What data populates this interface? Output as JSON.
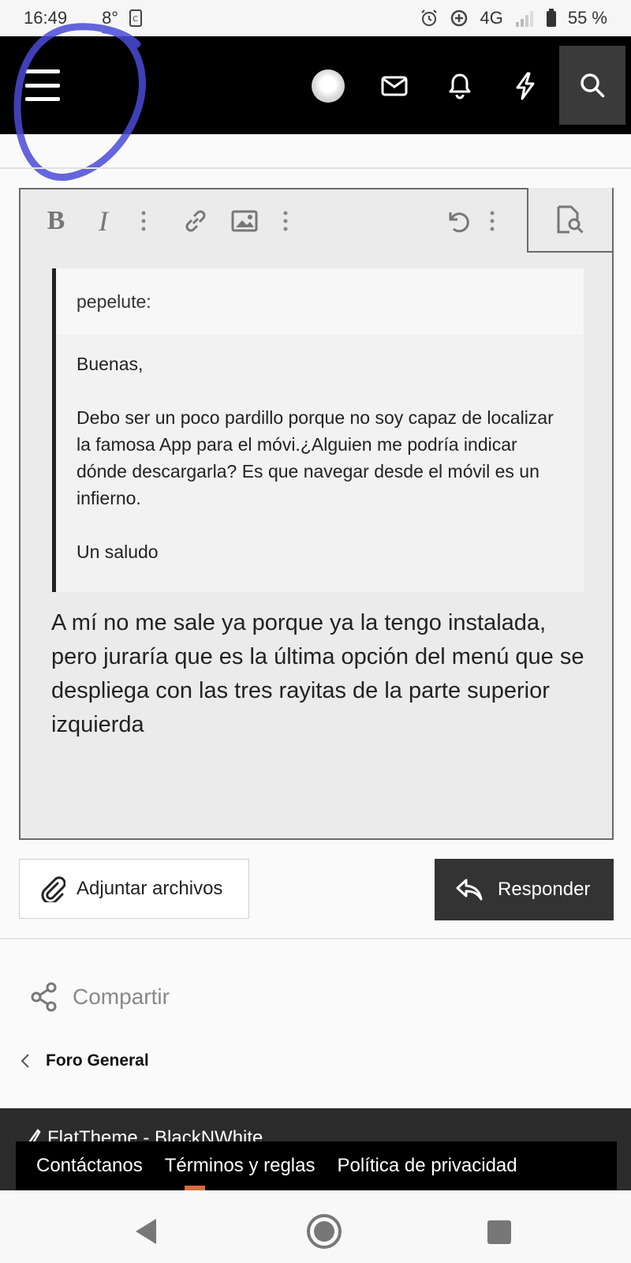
{
  "status_bar": {
    "time": "16:49",
    "temperature": "8°",
    "network": "4G",
    "battery": "55 %"
  },
  "topnav": {
    "icons": [
      "menu-icon",
      "avatar",
      "mail-icon",
      "bell-icon",
      "bolt-icon",
      "search-icon"
    ],
    "annotation_color": "#4a4ad8"
  },
  "editor": {
    "toolbar": [
      "bold-icon",
      "italic-icon",
      "more-icon",
      "link-icon",
      "image-icon",
      "more-icon",
      "undo-icon",
      "more-icon",
      "preview-icon"
    ],
    "bold_label": "B",
    "italic_label": "I",
    "quote": {
      "author": "pepelute:",
      "paragraphs": [
        "Buenas,",
        "Debo ser un poco pardillo porque no soy capaz de localizar la famosa App para el móvi.¿Alguien me podría indicar dónde descargarla? Es que navegar desde el móvil es un infierno.",
        "Un saludo"
      ]
    },
    "reply_text": "A mí no me sale ya porque ya la tengo instalada, pero juraría que es la última opción del menú que se despliega con las tres rayitas de la parte superior izquierda"
  },
  "actions": {
    "attach_label": "Adjuntar archivos",
    "reply_label": "Responder"
  },
  "share_label": "Compartir",
  "breadcrumb": "Foro General",
  "footer": {
    "theme": "FlatTheme - BlackNWhite",
    "links": [
      "Contáctanos",
      "Términos y reglas",
      "Política de privacidad"
    ]
  },
  "colors": {
    "nav_bg": "#000000",
    "reply_button": "#333333",
    "footer_bg": "#2b2b2b"
  }
}
